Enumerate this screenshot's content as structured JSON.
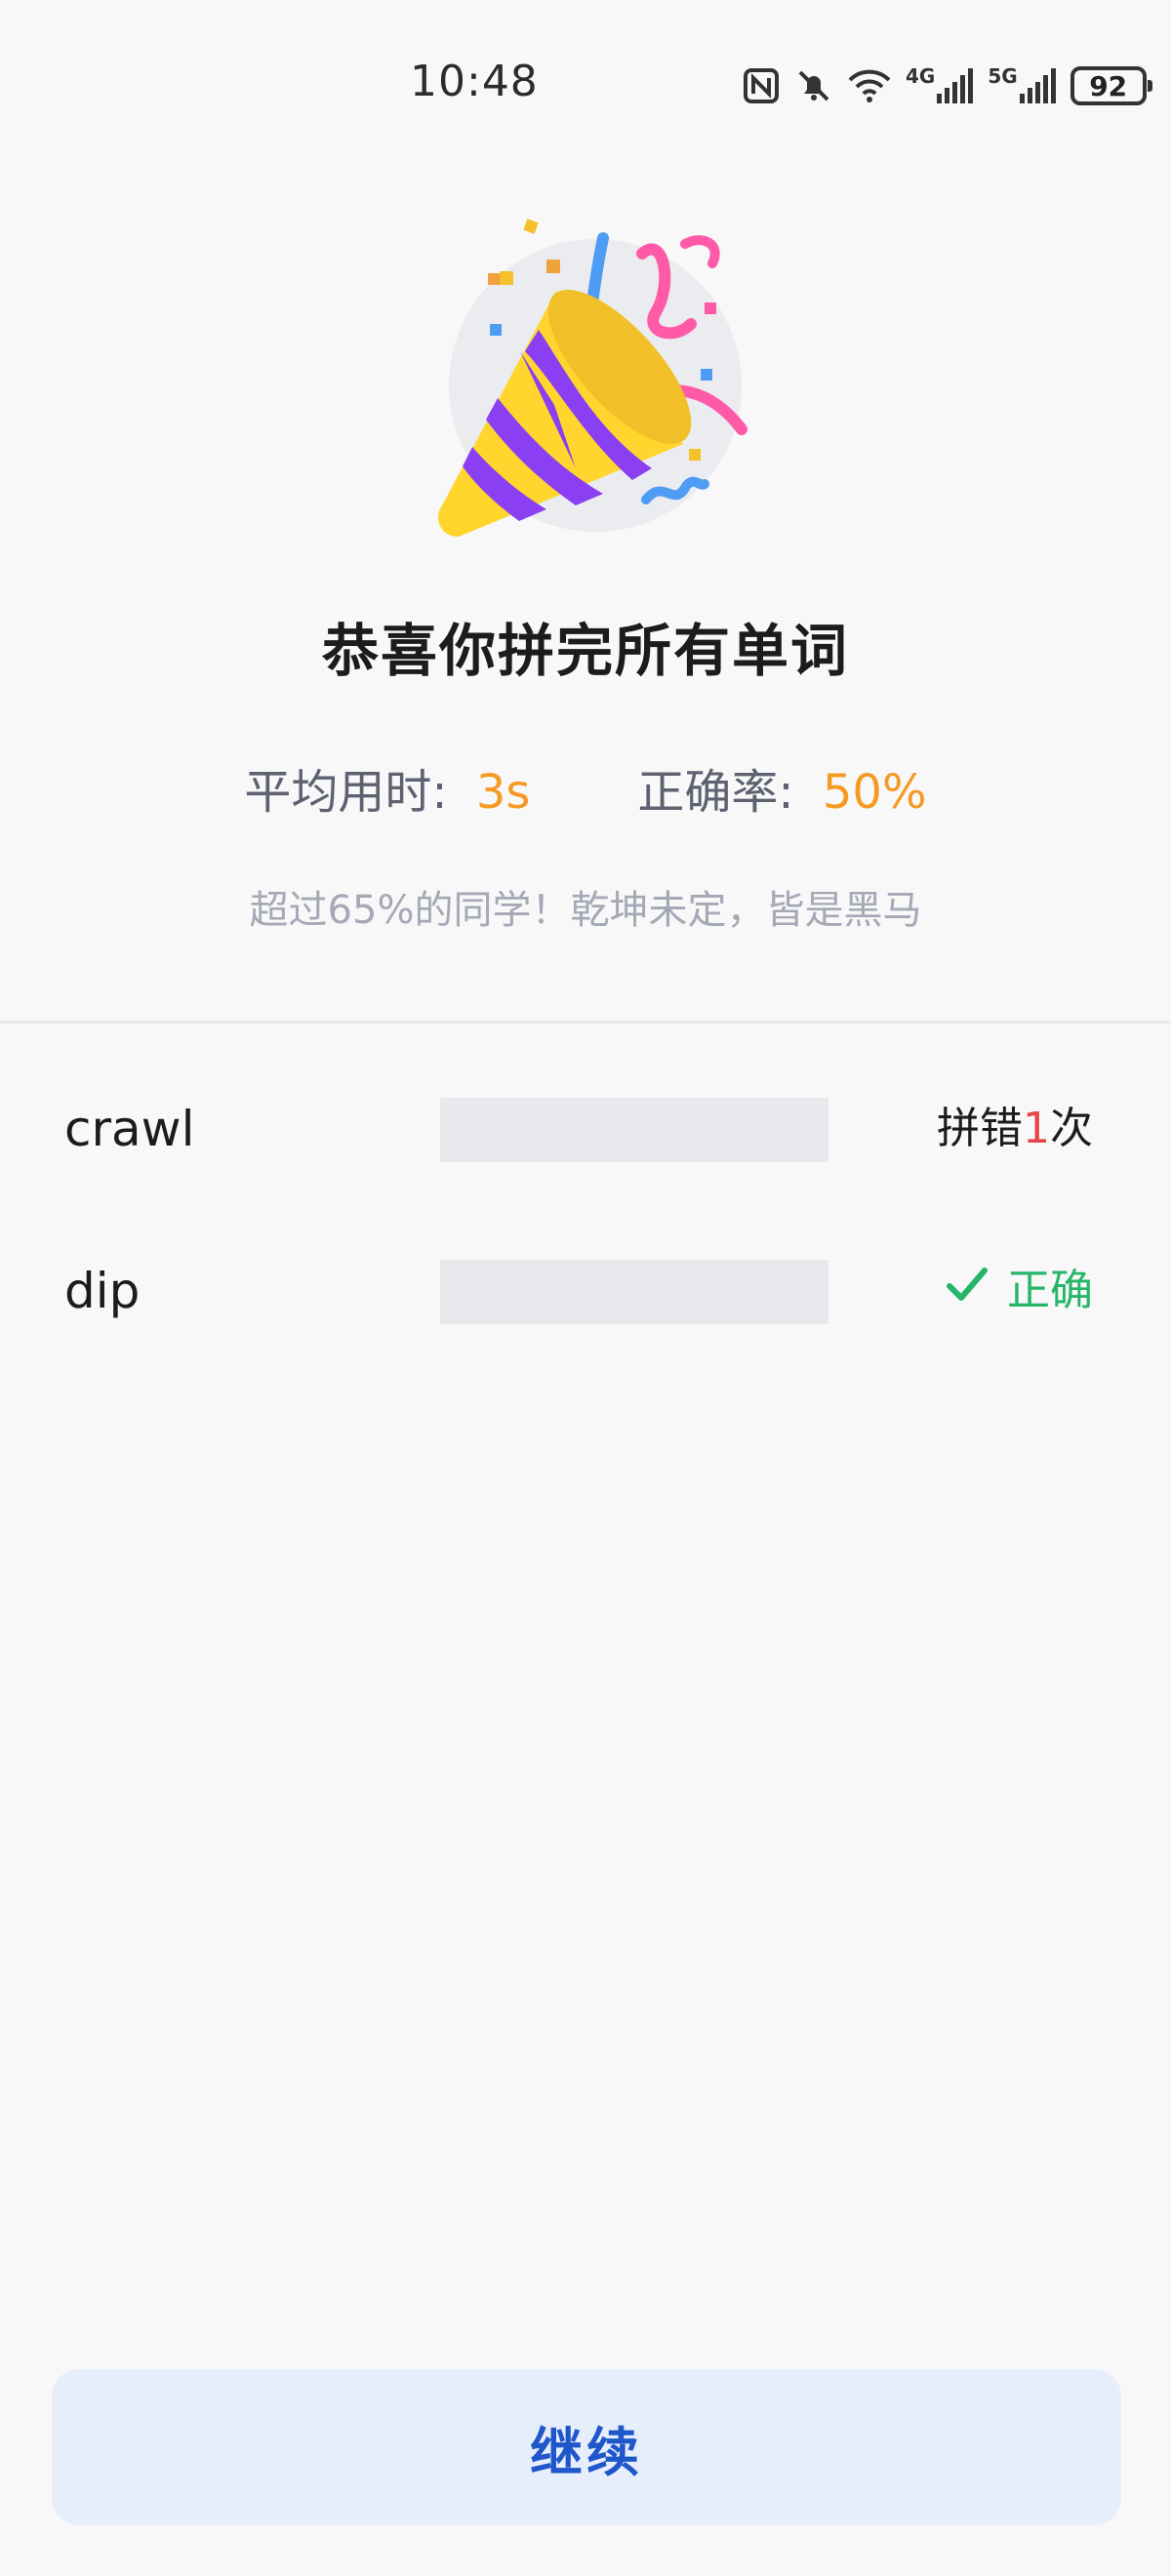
{
  "status_bar": {
    "time": "10:48",
    "net1": "4G",
    "net2": "5G",
    "battery": "92",
    "icons": [
      "nfc-icon",
      "mute-icon",
      "wifi-icon",
      "signal-icon",
      "signal-icon",
      "battery-icon"
    ]
  },
  "hero": {
    "icon": "party-popper-icon"
  },
  "title": "恭喜你拼完所有单词",
  "stats": {
    "avg_time_label": "平均用时:",
    "avg_time_value": "3s",
    "accuracy_label": "正确率:",
    "accuracy_value": "50%"
  },
  "subtitle": "超过65%的同学！乾坤未定，皆是黑马",
  "words": [
    {
      "word": "crawl",
      "result_prefix": "拼错",
      "result_count": "1",
      "result_suffix": "次",
      "status": "wrong"
    },
    {
      "word": "dip",
      "result_text": "正确",
      "status": "correct"
    }
  ],
  "continue_label": "继续",
  "colors": {
    "accent_orange": "#f59a23",
    "correct_green": "#27b569",
    "error_red": "#e8454a",
    "button_blue": "#1f56c9",
    "button_bg": "#e6edfb"
  }
}
